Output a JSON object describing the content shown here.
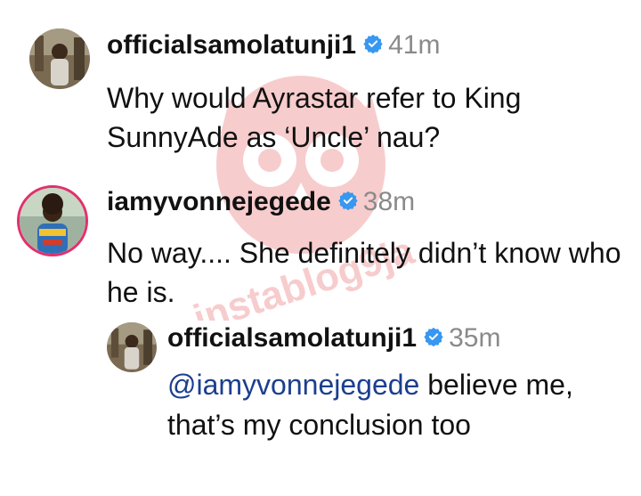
{
  "comments": [
    {
      "username": "officialsamolatunji1",
      "time": "41m",
      "text": "Why would Ayrastar refer to King SunnyAde as ‘Uncle’ nau?",
      "avatar": "avatar-samolatunji"
    },
    {
      "username": "iamyvonnejegede",
      "time": "38m",
      "text": "No way.... She definitely didn’t know who he is.",
      "avatar": "avatar-yvonnejegede"
    }
  ],
  "reply": {
    "username": "officialsamolatunji1",
    "time": "35m",
    "mention": "@iamyvonnejegede",
    "text": " believe me, that’s my conclusion too",
    "avatar": "avatar-samolatunji"
  },
  "icons": {
    "verified": "verified-badge-icon",
    "watermark": "instablog9ja-owl-watermark"
  },
  "watermark_text": "instablog9ja",
  "colors": {
    "verified": "#3897f0",
    "time": "#8a8a8a",
    "mention": "#1b3f8f",
    "watermark": "#e8525a",
    "story_ring": "#e1306c"
  }
}
